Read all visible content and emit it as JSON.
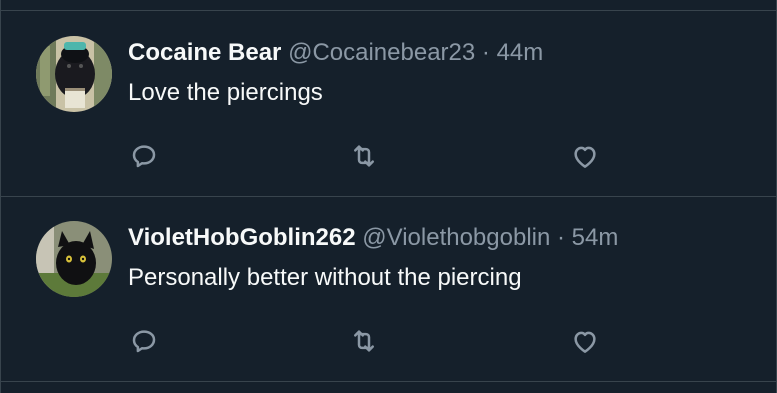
{
  "replies": [
    {
      "display_name": "Cocaine Bear",
      "handle": "@Cocainebear23",
      "separator": "·",
      "time": "44m",
      "text": "Love the piercings",
      "avatar_icon": "bear-avatar"
    },
    {
      "display_name": "VioletHobGoblin262",
      "handle": "@Violethobgoblin",
      "separator": "·",
      "time": "54m",
      "text": "Personally better without the piercing",
      "avatar_icon": "black-cat-avatar"
    }
  ],
  "colors": {
    "background": "#15202b",
    "divider": "#38444d",
    "primary_text": "#f7f9f9",
    "secondary_text": "#8b98a5",
    "icon": "#8b98a5"
  }
}
